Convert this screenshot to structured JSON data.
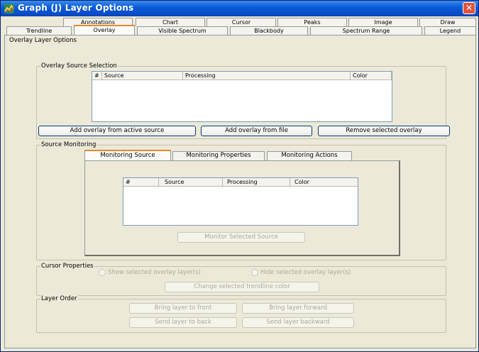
{
  "window": {
    "title": "Graph (J) Layer Options",
    "close_glyph": "✕"
  },
  "tabs_row1": [
    "Annotations",
    "Chart",
    "Cursor",
    "Peaks",
    "Image",
    "Draw"
  ],
  "tabs_row2": [
    "Trendline",
    "Overlay",
    "Visible Spectrum",
    "Blackbody",
    "Spectrum Range",
    "Legend"
  ],
  "active_tab": "Overlay",
  "panel_title": "Overlay Layer Options",
  "overlay_source": {
    "legend": "Overlay Source Selection",
    "columns": [
      "#",
      "Source",
      "Processing",
      "Color"
    ],
    "buttons": {
      "add_active": "Add overlay from active source",
      "add_file": "Add overlay from file",
      "remove": "Remove selected overlay"
    }
  },
  "source_monitoring": {
    "legend": "Source Monitoring",
    "tabs": [
      "Monitoring Source",
      "Monitoring Properties",
      "Monitoring Actions"
    ],
    "active_tab": "Monitoring Source",
    "columns": [
      "#",
      "Source",
      "Processing",
      "Color"
    ],
    "monitor_button": "Monitor Selected Source"
  },
  "cursor_properties": {
    "legend": "Cursor Properties",
    "radio_show": "Show selected overlay layer(s)",
    "radio_hide": "Hide selected overlay layer(s)",
    "change_color_button": "Change selected trendline color"
  },
  "layer_order": {
    "legend": "Layer Order",
    "bring_front": "Bring layer to front",
    "bring_forward": "Bring layer forward",
    "send_back": "Send layer to back",
    "send_backward": "Send layer backward"
  },
  "colors": {
    "titlebar": "#0a5ad6",
    "window_bg": "#ece9d8",
    "active_tab_accent": "#e68b2c",
    "close_button": "#e2543c"
  },
  "icons": {
    "app": "graph-app-icon",
    "close": "close-icon"
  }
}
